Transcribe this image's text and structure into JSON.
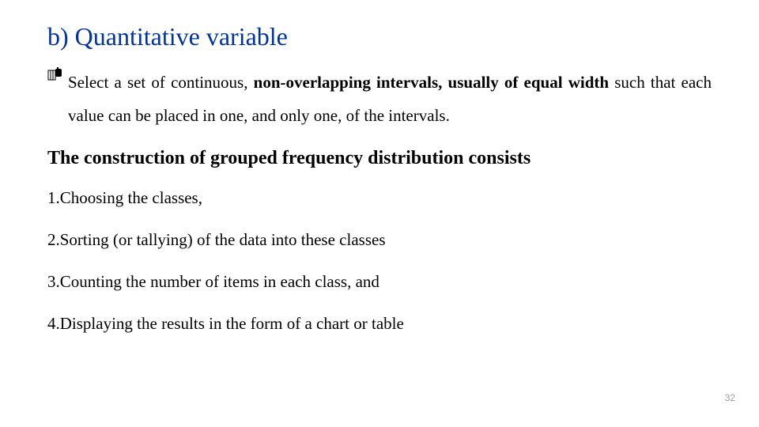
{
  "title": "b) Quantitative variable",
  "bullet": {
    "icon": "hand-icon",
    "p1": "Select a set of continuous, ",
    "p2": "non-overlapping  intervals, usually of equal width",
    "p3": " such that each value can be placed in one, and only one, of the intervals."
  },
  "subhead": "The construction of grouped frequency distribution consists",
  "items": [
    "1.Choosing the classes,",
    "2.Sorting (or tallying) of the data into these classes",
    "3.Counting the number of items in each class, and",
    "4.Displaying the results in the form of a chart or table"
  ],
  "pagenum": "32"
}
